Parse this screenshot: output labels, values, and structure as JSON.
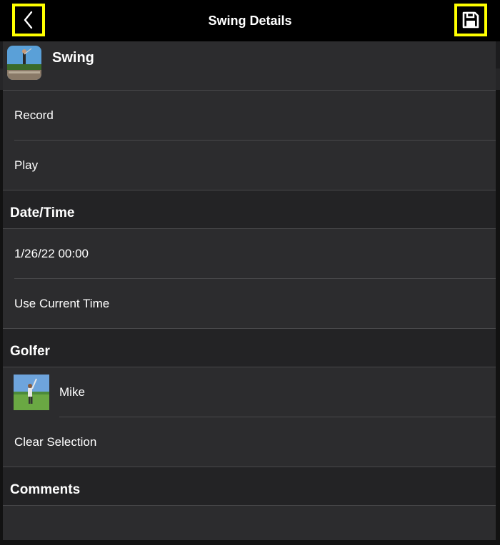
{
  "nav": {
    "title": "Swing Details",
    "back_icon": "chevron-left-icon",
    "save_icon": "floppy-disk-icon",
    "highlight_color": "#ffff00"
  },
  "swing": {
    "title": "Swing"
  },
  "media_rows": [
    {
      "label": "Record"
    },
    {
      "label": "Play"
    }
  ],
  "date_time": {
    "header": "Date/Time",
    "rows": [
      {
        "label": "1/26/22 00:00"
      },
      {
        "label": "Use Current Time"
      }
    ]
  },
  "golfer": {
    "header": "Golfer",
    "selected": "Mike",
    "clear_label": "Clear Selection"
  },
  "comments": {
    "header": "Comments",
    "value": ""
  }
}
